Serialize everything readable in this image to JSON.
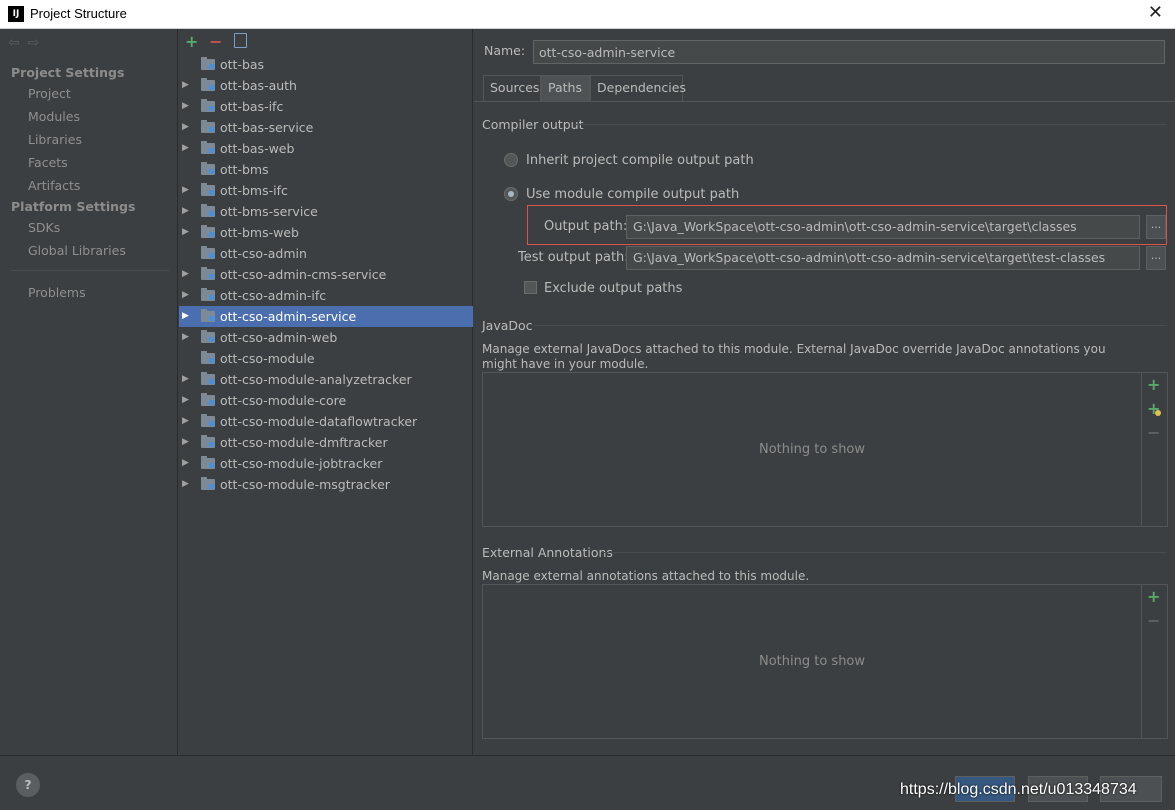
{
  "window": {
    "title": "Project Structure",
    "app_icon": "IJ"
  },
  "left_nav": {
    "project_settings_label": "Project Settings",
    "project_items": [
      "Project",
      "Modules",
      "Libraries",
      "Facets",
      "Artifacts"
    ],
    "platform_settings_label": "Platform Settings",
    "platform_items": [
      "SDKs",
      "Global Libraries"
    ],
    "problems_label": "Problems"
  },
  "modules": [
    {
      "name": "ott-bas",
      "expandable": false
    },
    {
      "name": "ott-bas-auth",
      "expandable": true
    },
    {
      "name": "ott-bas-ifc",
      "expandable": true
    },
    {
      "name": "ott-bas-service",
      "expandable": true
    },
    {
      "name": "ott-bas-web",
      "expandable": true
    },
    {
      "name": "ott-bms",
      "expandable": false
    },
    {
      "name": "ott-bms-ifc",
      "expandable": true
    },
    {
      "name": "ott-bms-service",
      "expandable": true
    },
    {
      "name": "ott-bms-web",
      "expandable": true
    },
    {
      "name": "ott-cso-admin",
      "expandable": false
    },
    {
      "name": "ott-cso-admin-cms-service",
      "expandable": true
    },
    {
      "name": "ott-cso-admin-ifc",
      "expandable": true
    },
    {
      "name": "ott-cso-admin-service",
      "expandable": true,
      "selected": true
    },
    {
      "name": "ott-cso-admin-web",
      "expandable": true
    },
    {
      "name": "ott-cso-module",
      "expandable": false
    },
    {
      "name": "ott-cso-module-analyzetracker",
      "expandable": true
    },
    {
      "name": "ott-cso-module-core",
      "expandable": true
    },
    {
      "name": "ott-cso-module-dataflowtracker",
      "expandable": true
    },
    {
      "name": "ott-cso-module-dmftracker",
      "expandable": true
    },
    {
      "name": "ott-cso-module-jobtracker",
      "expandable": true
    },
    {
      "name": "ott-cso-module-msgtracker",
      "expandable": true
    }
  ],
  "detail": {
    "name_label": "Name:",
    "name_value": "ott-cso-admin-service",
    "tabs": [
      "Sources",
      "Paths",
      "Dependencies"
    ],
    "active_tab": "Paths",
    "compiler_output_label": "Compiler output",
    "inherit_label": "Inherit project compile output path",
    "use_module_label": "Use module compile output path",
    "output_path_label": "Output path:",
    "output_path_value": "G:\\Java_WorkSpace\\ott-cso-admin\\ott-cso-admin-service\\target\\classes",
    "test_output_label": "Test output path:",
    "test_output_value": "G:\\Java_WorkSpace\\ott-cso-admin\\ott-cso-admin-service\\target\\test-classes",
    "browse_label": "...",
    "exclude_label": "Exclude output paths",
    "javadoc_label": "JavaDoc",
    "javadoc_desc": "Manage external JavaDocs attached to this module. External JavaDoc override JavaDoc annotations you might have in your module.",
    "empty_text": "Nothing to show",
    "ext_ann_label": "External Annotations",
    "ext_ann_desc": "Manage external annotations attached to this module."
  },
  "footer": {
    "help": "?",
    "watermark": "https://blog.csdn.net/u013348734"
  },
  "colors": {
    "selection": "#4b6eaf",
    "add_green": "#59a869",
    "remove_red": "#c75450",
    "highlight_box": "#d9534f"
  }
}
